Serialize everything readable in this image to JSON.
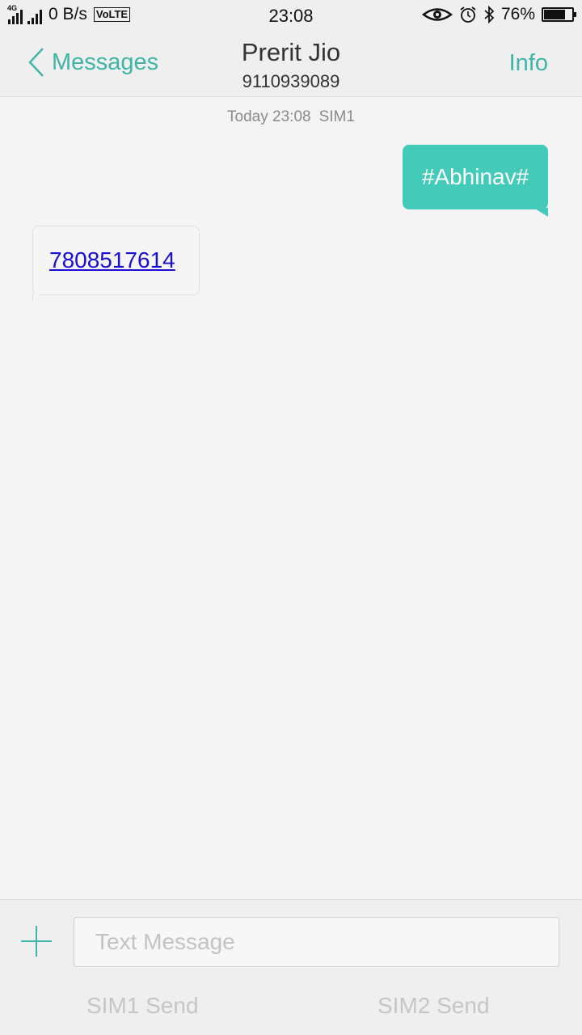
{
  "status_bar": {
    "network_label": "4G",
    "net_speed": "0 B/s",
    "volte": "VoLTE",
    "time": "23:08",
    "battery_percent_text": "76%",
    "battery_level": 0.76,
    "icons": [
      "eye-icon",
      "alarm-icon",
      "bluetooth-icon",
      "battery-icon"
    ]
  },
  "header": {
    "back_label": "Messages",
    "contact_name": "Prerit Jio",
    "contact_number": "9110939089",
    "info_label": "Info"
  },
  "thread": {
    "timestamp": "Today 23:08",
    "sim_label": "SIM1",
    "messages": [
      {
        "direction": "outgoing",
        "text": "#Abhinav#"
      },
      {
        "direction": "incoming",
        "text": "7808517614",
        "is_link": true
      }
    ]
  },
  "composer": {
    "placeholder": "Text Message",
    "value": "",
    "sim1_send": "SIM1 Send",
    "sim2_send": "SIM2 Send"
  },
  "colors": {
    "accent": "#3fb5a6",
    "outgoing_bubble": "#43cab8",
    "link": "#1a0dd4",
    "background": "#f4f4f4"
  }
}
